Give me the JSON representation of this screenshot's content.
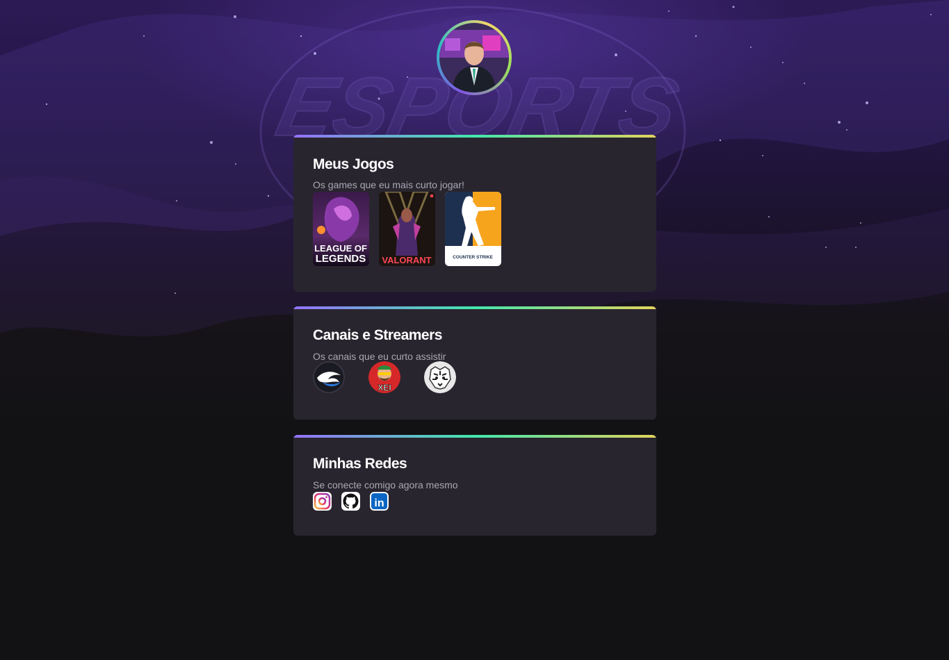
{
  "profile": {
    "avatar_alt": "Foto de perfil"
  },
  "background": {
    "watermark": "ESPORTS"
  },
  "sections": {
    "games": {
      "title": "Meus Jogos",
      "subtitle": "Os games que eu mais curto jogar!",
      "items": [
        {
          "name": "league-of-legends",
          "label_line1": "LEAGUE OF",
          "label_line2": "LEGENDS"
        },
        {
          "name": "valorant",
          "label": "VALORANT"
        },
        {
          "name": "counter-strike",
          "label": "COUNTER STRIKE"
        }
      ]
    },
    "channels": {
      "title": "Canais e Streamers",
      "subtitle": "Os canais que eu curto assistir",
      "items": [
        {
          "name": "channel-wings"
        },
        {
          "name": "channel-xei",
          "label": "XEI"
        },
        {
          "name": "channel-tiger"
        }
      ]
    },
    "socials": {
      "title": "Minhas Redes",
      "subtitle": "Se conecte comigo agora mesmo",
      "items": [
        {
          "name": "instagram",
          "icon": "instagram-icon"
        },
        {
          "name": "github",
          "icon": "github-icon"
        },
        {
          "name": "linkedin",
          "icon": "linkedin-icon",
          "label": "in"
        }
      ]
    }
  },
  "colors": {
    "background": "#121214",
    "card": "#29252f",
    "accent_gradient": [
      "#9572fc",
      "#43e7ad",
      "#e2d45c"
    ],
    "text_primary": "#ffffff",
    "text_secondary": "#a8a8b3"
  }
}
